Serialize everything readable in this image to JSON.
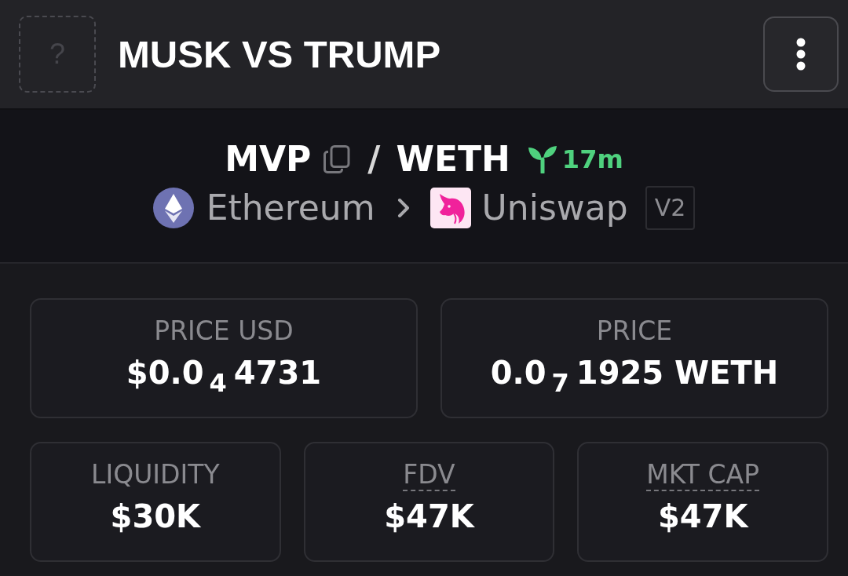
{
  "header": {
    "image_placeholder": "?",
    "title": "MUSK VS TRUMP"
  },
  "pair": {
    "base": "MVP",
    "separator": "/",
    "quote": "WETH",
    "age": "17m",
    "chain": "Ethereum",
    "dex": "Uniswap",
    "version": "V2"
  },
  "stat_rows": [
    [
      {
        "label": "PRICE USD",
        "value": "$0.0$_{4}$4731",
        "has_tooltip": false
      },
      {
        "label": "PRICE",
        "value": "0.0$_{7}$1925 WETH",
        "has_tooltip": false
      }
    ],
    [
      {
        "label": "LIQUIDITY",
        "value": "$30K",
        "has_tooltip": false
      },
      {
        "label": "FDV",
        "value": "$47K",
        "has_tooltip": true
      },
      {
        "label": "MKT CAP",
        "value": "$47K",
        "has_tooltip": true
      }
    ]
  ]
}
